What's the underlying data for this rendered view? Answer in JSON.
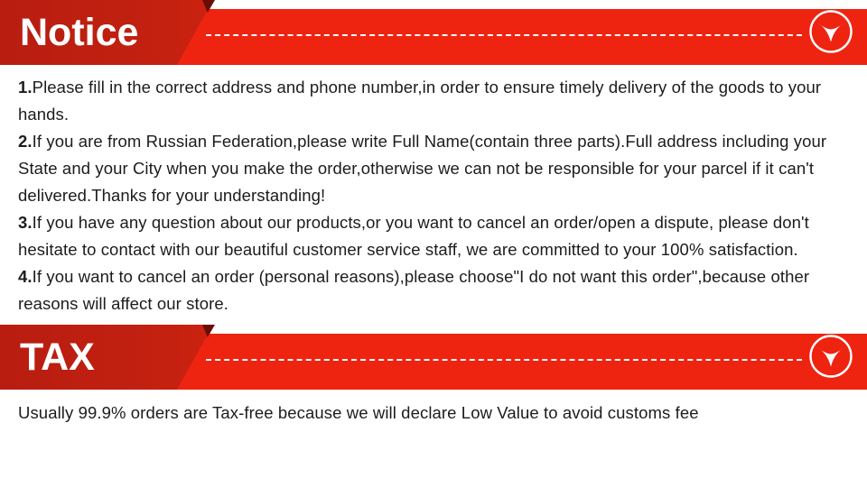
{
  "sections": [
    {
      "banner": {
        "title": "Notice",
        "icon": "chevron-down-circle-icon"
      },
      "paragraphs": [
        {
          "num": "1.",
          "text": "Please fill in the correct address and phone number,in order to ensure timely delivery of the goods to your hands."
        },
        {
          "num": "2.",
          "text": "If you are from Russian Federation,please write Full Name(contain three parts).Full address including your State and your City when you make the order,otherwise we can not be responsible for your parcel if it can't delivered.Thanks for your understanding!"
        },
        {
          "num": "3.",
          "text": "If you have any question about our products,or you want to cancel an order/open a dispute, please don't hesitate to contact with our beautiful customer service staff, we are committed to your 100% satisfaction."
        },
        {
          "num": "4.",
          "text": "If you want to cancel an order (personal reasons),please choose\"I do not want this order\",because other reasons will affect our store."
        }
      ]
    },
    {
      "banner": {
        "title": "TAX",
        "icon": "chevron-down-circle-icon"
      },
      "paragraphs": [
        {
          "num": "",
          "text": "Usually 99.9% orders are Tax-free because we will declare Low Value to avoid customs fee"
        }
      ]
    }
  ],
  "colors": {
    "label_red": "#c02010",
    "band_red": "#ee2411",
    "fold_dark": "#6b0d06",
    "text": "#1c1c1c",
    "white": "#ffffff"
  }
}
